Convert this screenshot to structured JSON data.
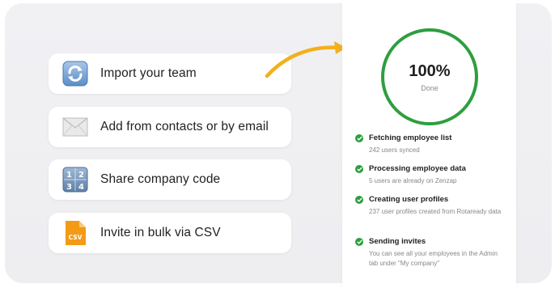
{
  "options": [
    {
      "label": "Import your team",
      "icon": "sync-icon"
    },
    {
      "label": "Add from contacts or by email",
      "icon": "envelope-icon"
    },
    {
      "label": "Share company code",
      "icon": "number-keypad-icon"
    },
    {
      "label": "Invite in bulk via CSV",
      "icon": "csv-file-icon"
    }
  ],
  "csv_icon_text": "CSV",
  "progress": {
    "percent_label": "100%",
    "percent_value": 100,
    "status": "Done",
    "color": "#2e9e3f"
  },
  "steps": [
    {
      "title": "Fetching employee list",
      "detail": "242 users synced"
    },
    {
      "title": "Processing employee data",
      "detail": "5 users are already on Zenzap"
    },
    {
      "title": "Creating user profiles",
      "detail": "237 user profiles created from Rotaready data"
    },
    {
      "title": "Sending invites",
      "detail": "You can see all your employees in the Admin tab under \"My company\""
    }
  ],
  "colors": {
    "accent_arrow": "#f2b01e",
    "success": "#2e9e3f",
    "csv_orange": "#f39a16"
  }
}
